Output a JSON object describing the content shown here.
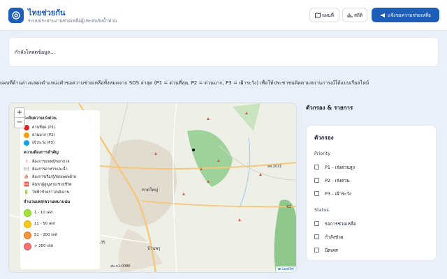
{
  "header": {
    "title": "ไทยช่วยกัน",
    "subtitle": "ระบบประสานงานช่วยเหลือผู้ประสบภัยน้ำท่วม",
    "buttons": {
      "map_label": "แผนที่",
      "stats_label": "สถิติ",
      "report_label": "แจ้งขอความช่วยเหลือ"
    }
  },
  "loading_text": "กำลังโหลดข้อมูล...",
  "description": "แผนที่ด้านล่างแสดงตำแหน่งคำขอความช่วยเหลือทั้งหมดจาก SOS ล่าสุด (P1 = ด่วนที่สุด, P2 = ด่วนมาก, P3 = เฝ้าระวัง) เพื่อให้ประชาชนติดตามสถานการณ์ได้แบบเรียลไทม์",
  "map": {
    "zoom_in": "+",
    "zoom_out": "−",
    "attribution": "Leaflet",
    "places": [
      "หาดใหญ่",
      "บ้านพรุ"
    ],
    "roads": [
      "4135",
      "43",
      "สล.2031",
      "สบ.ถ1-0086"
    ],
    "legend": {
      "urgency_title": "ระดับความเร่งด่วน",
      "urgency": [
        {
          "label": "ด่วนที่สุด (P1)",
          "color": "#dc2626"
        },
        {
          "label": "ด่วนมาก (P2)",
          "color": "#f59e0b"
        },
        {
          "label": "เฝ้าระวัง (P3)",
          "color": "#0ea5e9"
        }
      ],
      "needs_title": "ความต้องการสำคัญ",
      "needs": [
        {
          "icon": "medical-icon",
          "glyph": "⚕",
          "color": "#db2777",
          "label": "ต้องการแพทย์/พยาบาล"
        },
        {
          "icon": "food-icon",
          "glyph": "🍽",
          "color": "#6b7280",
          "label": "ต้องการอาหารและน้ำ"
        },
        {
          "icon": "boat-icon",
          "glyph": "⛵",
          "color": "#b45309",
          "label": "ต้องการเรือ/กู้ภัย/อพยพย้าย"
        },
        {
          "icon": "sos-icon",
          "glyph": "🆘",
          "color": "#dc2626",
          "label": "ค้นหาผู้สูญหาย/ช่วยชีวิต"
        },
        {
          "icon": "power-icon",
          "glyph": "🔋",
          "color": "#16a34a",
          "label": "ไฟฟ้าชั่วคราว/พลังงาน"
        }
      ],
      "count_title": "จำนวนเคส/ความหนาแน่น",
      "counts": [
        {
          "label": "1 - 10 เคส",
          "color": "#a3e635"
        },
        {
          "label": "11 - 50 เคส",
          "color": "#facc15"
        },
        {
          "label": "51 - 200 เคส",
          "color": "#fb923c"
        },
        {
          "label": "> 200 เคส",
          "color": "#f87171"
        }
      ]
    }
  },
  "sidebar": {
    "title": "ตัวกรอง & รายการ",
    "panel_title": "ตัวกรอง",
    "priority_label": "Priority",
    "priority": [
      "P1 - เร่งด่วนสูง",
      "P2 - เร่งด่วน",
      "P3 - เฝ้าระวัง"
    ],
    "status_label": "Status",
    "status": [
      "รอการช่วยเหลือ",
      "กำลังช่วย",
      "ปิดเคส"
    ]
  }
}
